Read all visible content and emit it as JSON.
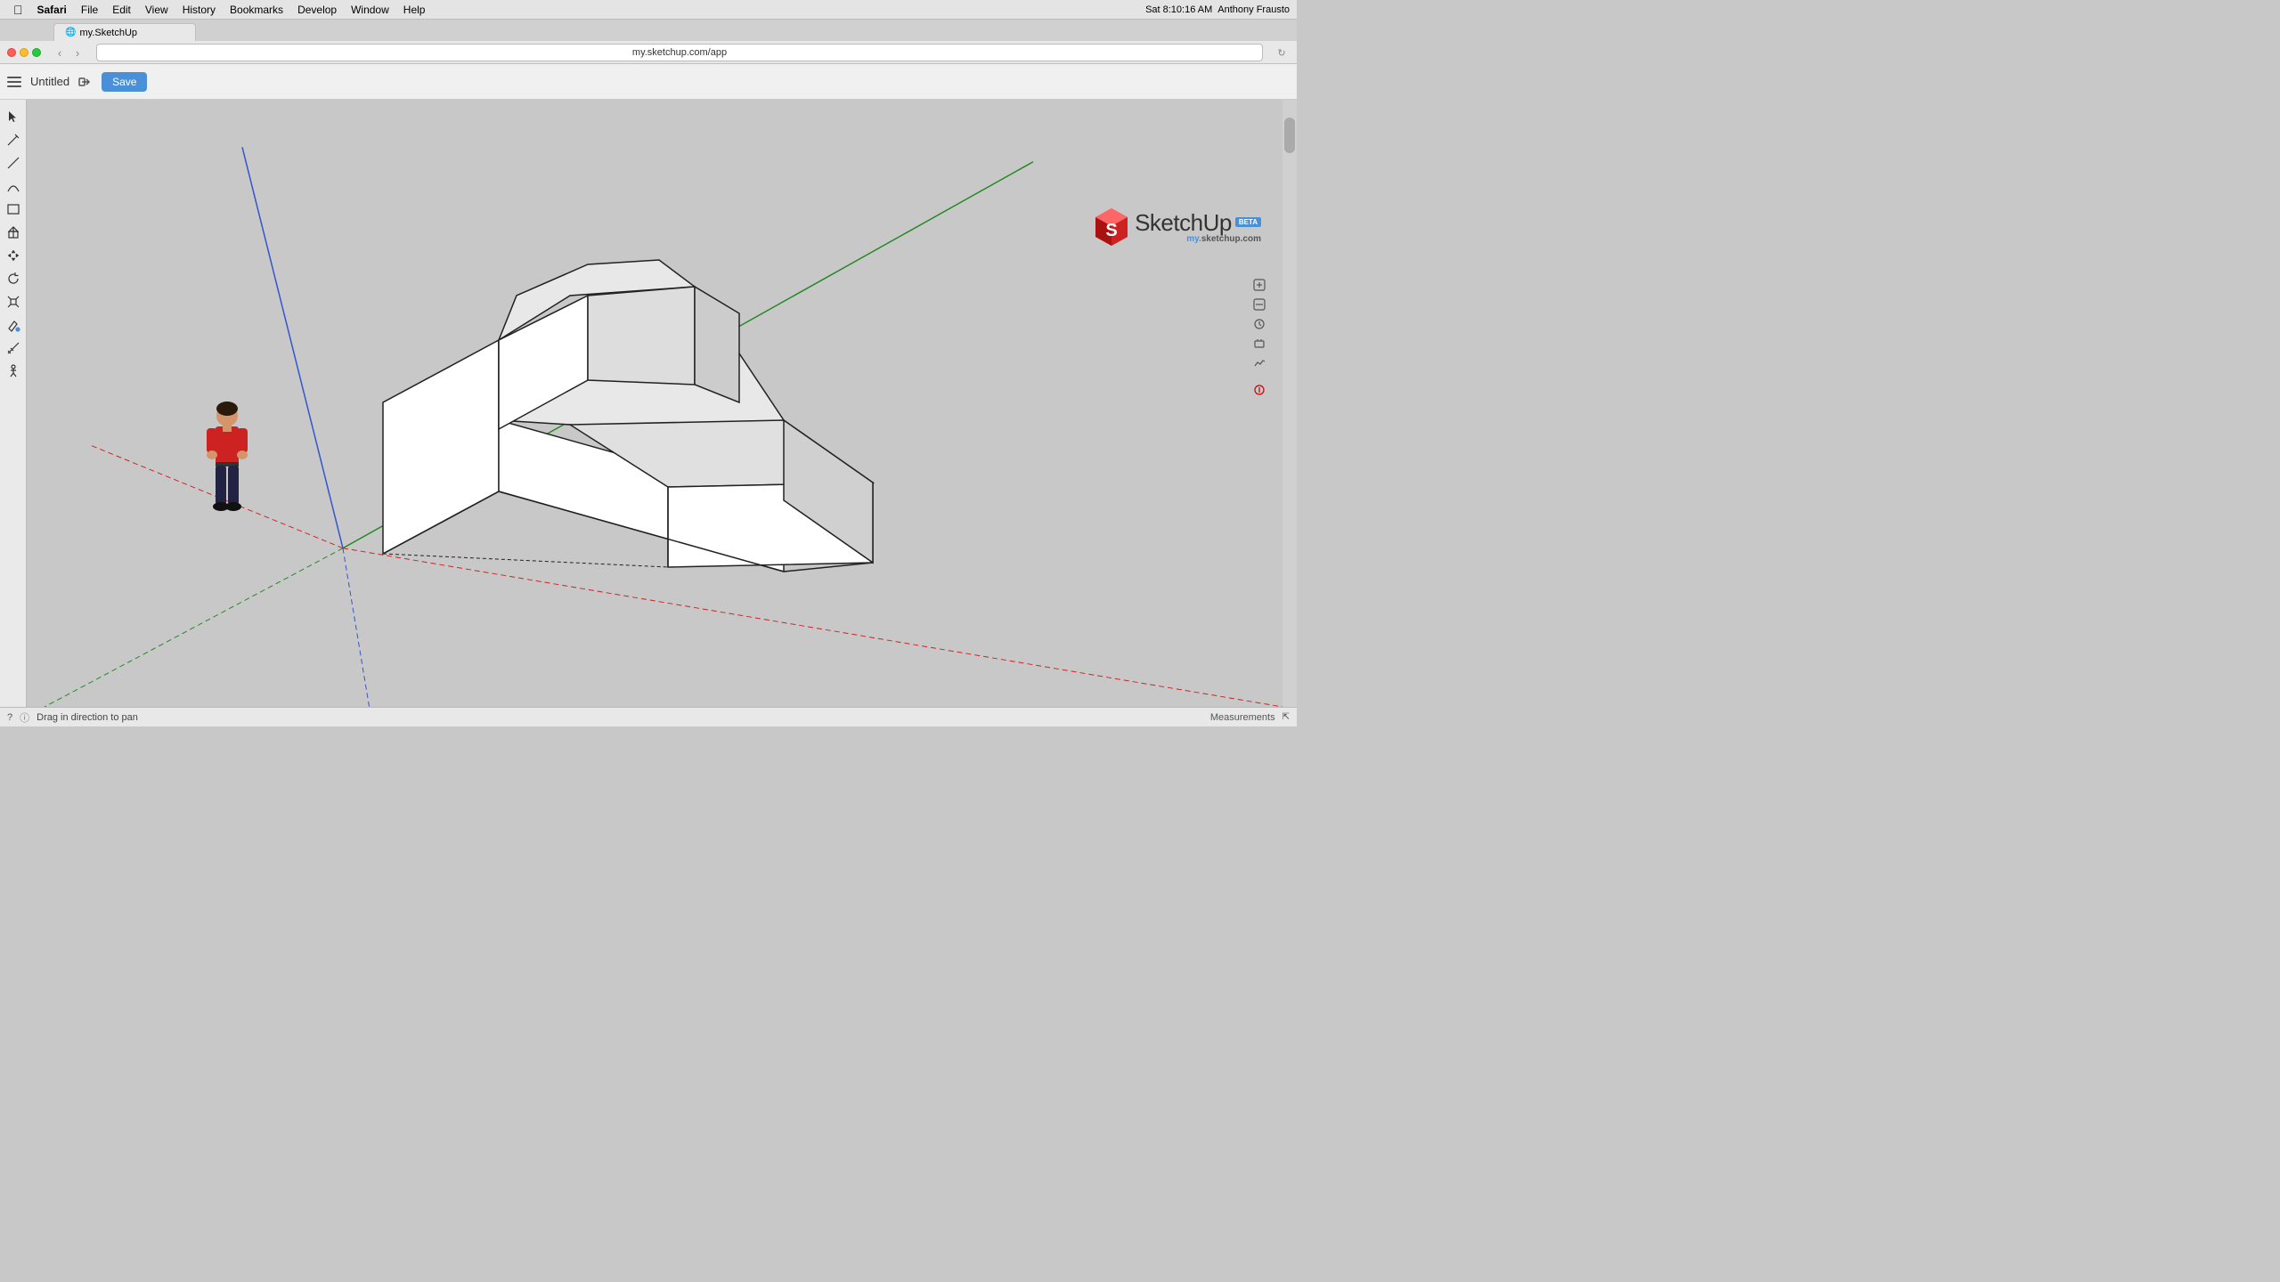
{
  "menubar": {
    "app": "Safari",
    "items": [
      "File",
      "Edit",
      "View",
      "History",
      "Bookmarks",
      "Develop",
      "Window",
      "Help"
    ],
    "time": "Sat 8:10:16 AM",
    "user": "Anthony Frausto"
  },
  "browser": {
    "tab_title": "my.SketchUp",
    "url": "my.sketchup.com/app"
  },
  "toolbar": {
    "title": "Untitled",
    "save_label": "Save"
  },
  "logo": {
    "name": "SketchUp",
    "badge": "BETA",
    "url_prefix": "my.",
    "url_domain": "sketchup.com"
  },
  "status": {
    "hint": "Drag in direction to pan",
    "measurements_label": "Measurements"
  },
  "tools": [
    {
      "name": "select",
      "icon": "▲"
    },
    {
      "name": "pencil",
      "icon": "✏"
    },
    {
      "name": "line",
      "icon": "/"
    },
    {
      "name": "arc",
      "icon": "⌒"
    },
    {
      "name": "shape",
      "icon": "□"
    },
    {
      "name": "push-pull",
      "icon": "⬡"
    },
    {
      "name": "move",
      "icon": "✥"
    },
    {
      "name": "rotate",
      "icon": "↻"
    },
    {
      "name": "scale",
      "icon": "⤡"
    },
    {
      "name": "paint",
      "icon": "🪣"
    },
    {
      "name": "measure",
      "icon": "📐"
    },
    {
      "name": "walk",
      "icon": "👤"
    }
  ],
  "axes": {
    "red_color": "#cc0000",
    "green_color": "#00aa00",
    "blue_color": "#0000cc",
    "red_dashed": "#cc4444",
    "green_dashed": "#44aa44",
    "blue_dashed": "#4444cc"
  }
}
